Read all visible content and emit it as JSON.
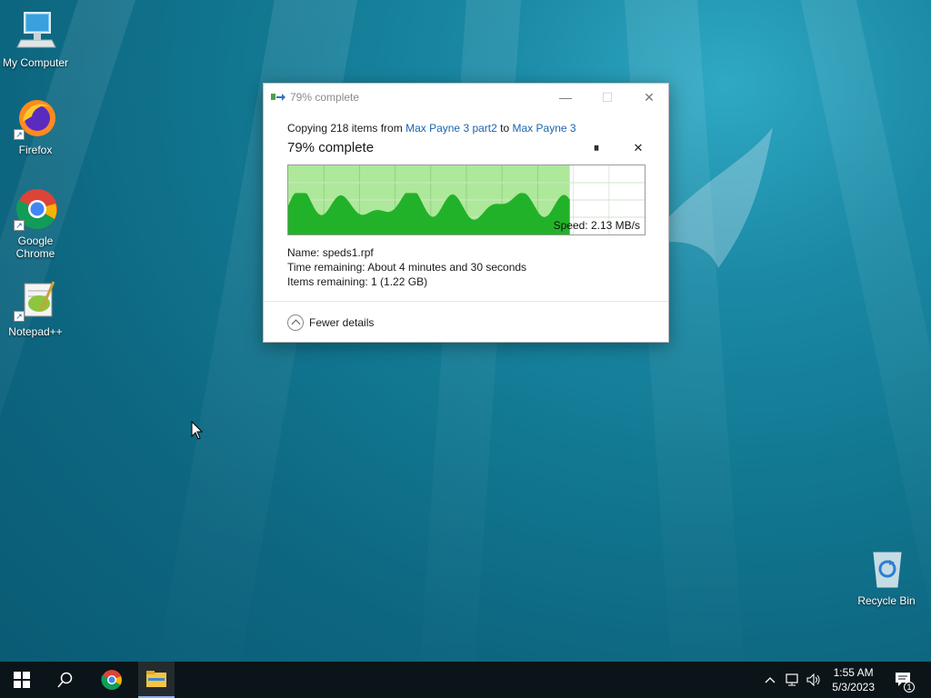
{
  "desktop": {
    "icons": [
      {
        "label": "My Computer"
      },
      {
        "label": "Firefox"
      },
      {
        "label": "Google Chrome"
      },
      {
        "label": "Notepad++"
      },
      {
        "label": "Recycle Bin"
      }
    ]
  },
  "dialog": {
    "title": "79% complete",
    "copying_prefix": "Copying 218 items from",
    "source": "Max Payne 3 part2",
    "to_word": "to",
    "destination": "Max Payne 3",
    "progress_text": "79% complete",
    "progress": 0.79,
    "speed": "Speed: 2.13 MB/s",
    "name_label": "Name:",
    "name_value": "speds1.rpf",
    "time_label": "Time remaining:",
    "time_value": "About 4 minutes and 30 seconds",
    "items_label": "Items remaining:",
    "items_value": "1 (1.22 GB)",
    "fewer_details": "Fewer details",
    "colors": {
      "graph_fill": "#22b229",
      "graph_bg": "#aee89a",
      "link": "#1a64b0"
    }
  },
  "taskbar": {
    "time": "1:55 AM",
    "date": "5/3/2023",
    "notification_count": "1"
  }
}
